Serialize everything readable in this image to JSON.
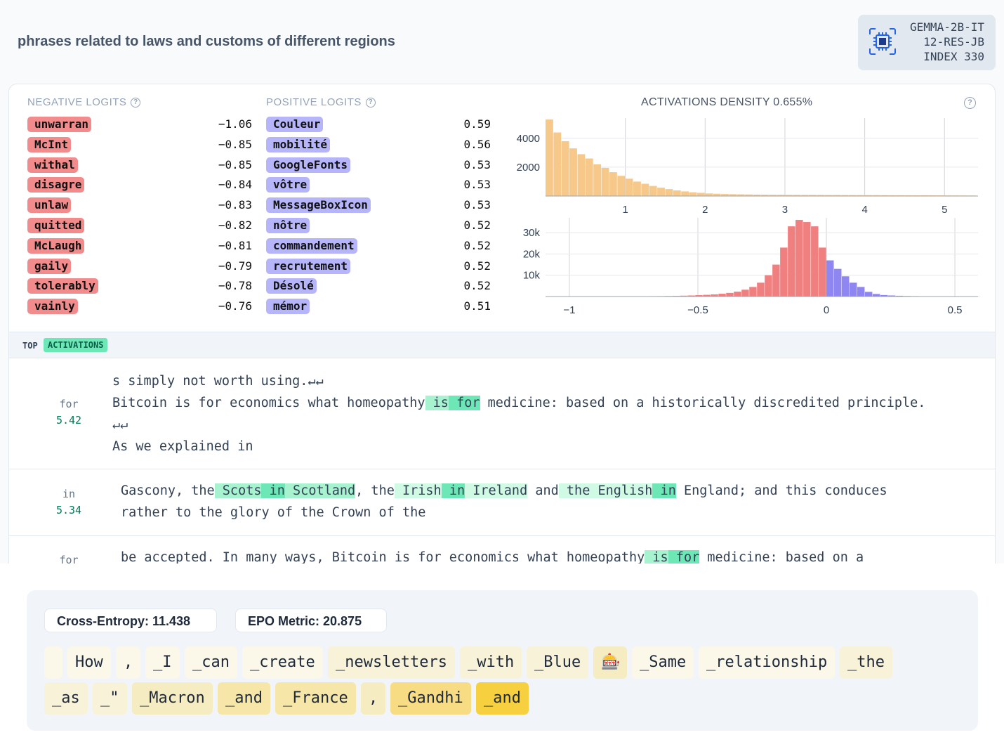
{
  "header": {
    "title": "phrases related to laws and customs of different regions",
    "model_lines": [
      "GEMMA-2B-IT",
      "12-RES-JB",
      "INDEX 330"
    ]
  },
  "negative_logits": {
    "label": "NEGATIVE LOGITS",
    "items": [
      {
        "token": "unwarran",
        "value": "−1.06"
      },
      {
        "token": "McInt",
        "value": "−0.85"
      },
      {
        "token": "withal",
        "value": "−0.85"
      },
      {
        "token": "disagre",
        "value": "−0.84"
      },
      {
        "token": "unlaw",
        "value": "−0.83"
      },
      {
        "token": "quitted",
        "value": "−0.82"
      },
      {
        "token": "McLaugh",
        "value": "−0.81"
      },
      {
        "token": "gaily",
        "value": "−0.79"
      },
      {
        "token": "tolerably",
        "value": "−0.78"
      },
      {
        "token": "vainly",
        "value": "−0.76"
      }
    ]
  },
  "positive_logits": {
    "label": "POSITIVE LOGITS",
    "items": [
      {
        "token": "Couleur",
        "value": "0.59"
      },
      {
        "token": "mobilité",
        "value": "0.56"
      },
      {
        "token": "GoogleFonts",
        "value": "0.53"
      },
      {
        "token": "vôtre",
        "value": "0.53"
      },
      {
        "token": "MessageBoxIcon",
        "value": "0.53"
      },
      {
        "token": "nôtre",
        "value": "0.52"
      },
      {
        "token": "commandement",
        "value": "0.52"
      },
      {
        "token": "recrutement",
        "value": "0.52"
      },
      {
        "token": "Désolé",
        "value": "0.52"
      },
      {
        "token": "mémor",
        "value": "0.51"
      }
    ]
  },
  "chart_data": [
    {
      "type": "bar",
      "title": "ACTIVATIONS DENSITY 0.655%",
      "x_ticks": [
        "1",
        "2",
        "3",
        "4",
        "5"
      ],
      "y_ticks": [
        "2000",
        "4000"
      ],
      "xlim": [
        0.0,
        5.42
      ],
      "ylim": [
        0,
        5400
      ],
      "bin_width": 0.1,
      "values": [
        5300,
        4400,
        3800,
        3300,
        2900,
        2600,
        2200,
        1950,
        1650,
        1400,
        1200,
        1000,
        850,
        700,
        580,
        480,
        390,
        320,
        260,
        220,
        180,
        160,
        140,
        130,
        120,
        110,
        100,
        95,
        90,
        88,
        85,
        83,
        80,
        78,
        76,
        74,
        72,
        70,
        68,
        66,
        64,
        62,
        60,
        58,
        56,
        54,
        52,
        50,
        48,
        46,
        44,
        42,
        40,
        38
      ]
    },
    {
      "type": "bar",
      "x_ticks": [
        "−1",
        "−0.5",
        "0",
        "0.5"
      ],
      "y_ticks": [
        "10k",
        "20k",
        "30k"
      ],
      "xlim": [
        -1.06,
        0.59
      ],
      "ylim": [
        0,
        37000
      ],
      "bin_width": 0.03,
      "bin_start": -1.05,
      "values": [
        100,
        100,
        100,
        150,
        100,
        100,
        100,
        120,
        100,
        120,
        130,
        150,
        180,
        200,
        250,
        300,
        400,
        500,
        650,
        800,
        1000,
        1300,
        1700,
        2300,
        3200,
        4500,
        6500,
        10000,
        15000,
        23000,
        33000,
        36000,
        35000,
        33000,
        23000,
        17000,
        13000,
        9500,
        6500,
        4500,
        2200,
        1200,
        700,
        500,
        350,
        250,
        200,
        150,
        120,
        100,
        90,
        80,
        70,
        60,
        50
      ],
      "negative_color": "#f08080",
      "positive_color": "#8f86f2"
    }
  ],
  "top_activations": {
    "label_prefix": "TOP",
    "label": "ACTIVATIONS",
    "rows": [
      {
        "word": "for",
        "value": "5.42"
      },
      {
        "word": "in",
        "value": "5.34"
      },
      {
        "word": "for",
        "value": ""
      }
    ]
  },
  "metrics": {
    "cross_entropy": "Cross-Entropy: 11.438",
    "epo": "EPO Metric: 20.875"
  },
  "token_rows": [
    [
      {
        "t": " ",
        "c": 0
      },
      {
        "t": "How",
        "c": 0
      },
      {
        "t": ",",
        "c": 0
      },
      {
        "t": "_I",
        "c": 0
      },
      {
        "t": "_can",
        "c": 0
      },
      {
        "t": "_create",
        "c": 0
      },
      {
        "t": "_newsletters",
        "c": 1
      },
      {
        "t": "_with",
        "c": 1
      },
      {
        "t": "_Blue",
        "c": 1
      },
      {
        "t": "🎰",
        "c": 2
      },
      {
        "t": "_Same",
        "c": 0
      },
      {
        "t": "_relationship",
        "c": 0
      },
      {
        "t": "_the",
        "c": 1
      }
    ],
    [
      {
        "t": "_as",
        "c": 1
      },
      {
        "t": "_\"",
        "c": 1
      },
      {
        "t": "_Macron",
        "c": 2
      },
      {
        "t": "_and",
        "c": 3
      },
      {
        "t": "_France",
        "c": 3
      },
      {
        "t": ",",
        "c": 2
      },
      {
        "t": "_Gandhi",
        "c": 4
      },
      {
        "t": "_and",
        "c": 5
      }
    ]
  ],
  "colors": {
    "negative": "#f28b8b",
    "positive": "#b7b5fa",
    "highlight": "#6ee7b7",
    "accent": "#f6d03f"
  }
}
